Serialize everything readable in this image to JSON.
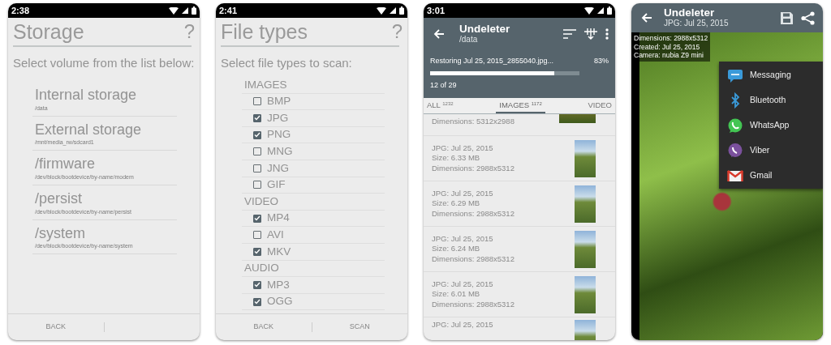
{
  "screens": [
    {
      "kind": "volumes",
      "status_time": "2:38",
      "title": "Storage",
      "help": "?",
      "prompt": "Select volume from the list below:",
      "volumes": [
        {
          "name": "Internal storage",
          "path": "/data"
        },
        {
          "name": "External storage",
          "path": "/mnt/media_rw/sdcard1"
        },
        {
          "name": "/firmware",
          "path": "/dev/block/bootdevice/by-name/modem"
        },
        {
          "name": "/persist",
          "path": "/dev/block/bootdevice/by-name/persist"
        },
        {
          "name": "/system",
          "path": "/dev/block/bootdevice/by-name/system"
        }
      ],
      "buttons": [
        "BACK"
      ]
    },
    {
      "kind": "file_types",
      "status_time": "2:41",
      "title": "File types",
      "help": "?",
      "prompt": "Select file types to scan:",
      "groups": [
        {
          "name": "IMAGES",
          "types": [
            {
              "label": "BMP",
              "checked": false
            },
            {
              "label": "JPG",
              "checked": true
            },
            {
              "label": "PNG",
              "checked": true
            },
            {
              "label": "MNG",
              "checked": false
            },
            {
              "label": "JNG",
              "checked": false
            },
            {
              "label": "GIF",
              "checked": false
            }
          ]
        },
        {
          "name": "VIDEO",
          "types": [
            {
              "label": "MP4",
              "checked": true
            },
            {
              "label": "AVI",
              "checked": false
            },
            {
              "label": "MKV",
              "checked": true
            }
          ]
        },
        {
          "name": "AUDIO",
          "types": [
            {
              "label": "MP3",
              "checked": true
            },
            {
              "label": "OGG",
              "checked": true
            }
          ]
        }
      ],
      "buttons": [
        "BACK",
        "SCAN"
      ]
    },
    {
      "kind": "results",
      "status_time": "3:01",
      "app_title": "Undeleter",
      "path": "/data",
      "progress": {
        "text": "Restoring Jul 25, 2015_2855040.jpg...",
        "percent": "83%",
        "level": 0.83,
        "count": "12 of 29"
      },
      "tabs": [
        {
          "label": "ALL $^{1232}$",
          "selected": false
        },
        {
          "label": "IMAGES $^{1172}$",
          "selected": true
        },
        {
          "label": "VIDEO",
          "selected": false
        }
      ],
      "files": [
        {
          "kind": "landscape",
          "lines": [
            "Dimensions: 5312x2988"
          ]
        },
        {
          "kind": "portrait",
          "lines": [
            "JPG: Jul 25, 2015",
            "Size: 6.33 MB",
            "Dimensions: 2988x5312"
          ]
        },
        {
          "kind": "portrait",
          "lines": [
            "JPG: Jul 25, 2015",
            "Size: 6.29 MB",
            "Dimensions: 2988x5312"
          ]
        },
        {
          "kind": "portrait",
          "lines": [
            "JPG: Jul 25, 2015",
            "Size: 6.24 MB",
            "Dimensions: 2988x5312"
          ]
        },
        {
          "kind": "portrait",
          "lines": [
            "JPG: Jul 25, 2015",
            "Size: 6.01 MB",
            "Dimensions: 2988x5312"
          ]
        },
        {
          "kind": "portrait",
          "lines": [
            "JPG: Jul 25, 2015"
          ]
        }
      ]
    },
    {
      "kind": "viewer",
      "app_title": "Undeleter",
      "subtitle": "JPG: Jul 25, 2015",
      "info": [
        "Dimensions: 2988x5312",
        "Created: Jul 25, 2015",
        "Camera: nubia Z9 mini"
      ],
      "share_targets": [
        {
          "label": "Messaging",
          "kind": "messaging"
        },
        {
          "label": "Bluetooth",
          "kind": "bluetooth"
        },
        {
          "label": "WhatsApp",
          "kind": "whatsapp"
        },
        {
          "label": "Viber",
          "kind": "viber"
        },
        {
          "label": "Gmail",
          "kind": "gmail"
        }
      ]
    }
  ]
}
